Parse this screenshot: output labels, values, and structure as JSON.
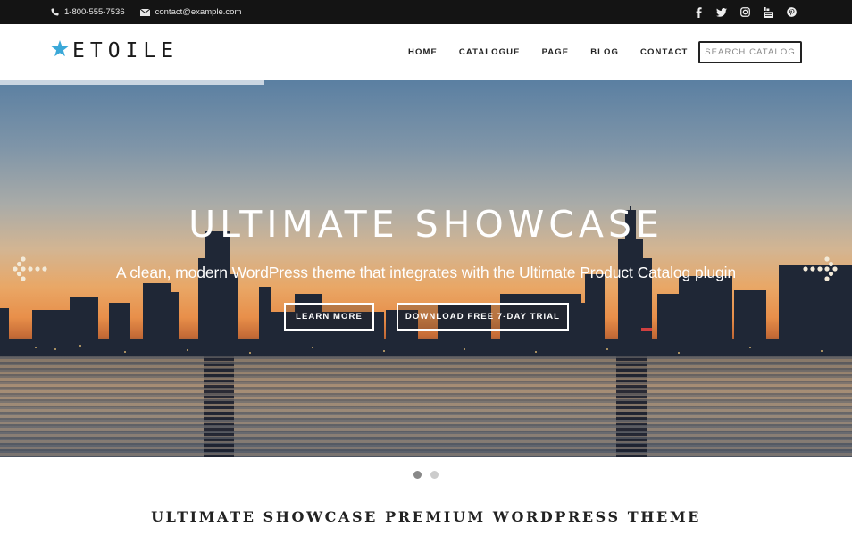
{
  "topbar": {
    "phone": "1-800-555-7536",
    "email": "contact@example.com",
    "phone_icon": "phone-icon",
    "email_icon": "envelope-icon",
    "social": [
      "facebook-icon",
      "twitter-icon",
      "instagram-icon",
      "youtube-icon",
      "pinterest-icon"
    ]
  },
  "header": {
    "logo_text": "ETOILE",
    "logo_icon": "star-icon",
    "nav": [
      "HOME",
      "CATALOGUE",
      "PAGE",
      "BLOG",
      "CONTACT"
    ],
    "search_placeholder": "SEARCH CATALOG"
  },
  "hero": {
    "title": "ULTIMATE SHOWCASE",
    "subtitle": "A clean, modern WordPress theme that integrates with the Ultimate Product Catalog plugin",
    "buttons": [
      "LEARN MORE",
      "DOWNLOAD FREE 7-DAY TRIAL"
    ],
    "slide_progress_percent": 31,
    "prev_icon": "arrow-left-icon",
    "next_icon": "arrow-right-icon"
  },
  "slider": {
    "slide_count": 2,
    "active_slide": 1
  },
  "section": {
    "title": "ULTIMATE SHOWCASE PREMIUM WORDPRESS THEME"
  },
  "colors": {
    "topbar_bg": "#141414",
    "accent_star": "#3aa8d8",
    "dot_active": "#888888",
    "dot_inactive": "#cccccc",
    "progress_fill": "#cbd6e2"
  }
}
